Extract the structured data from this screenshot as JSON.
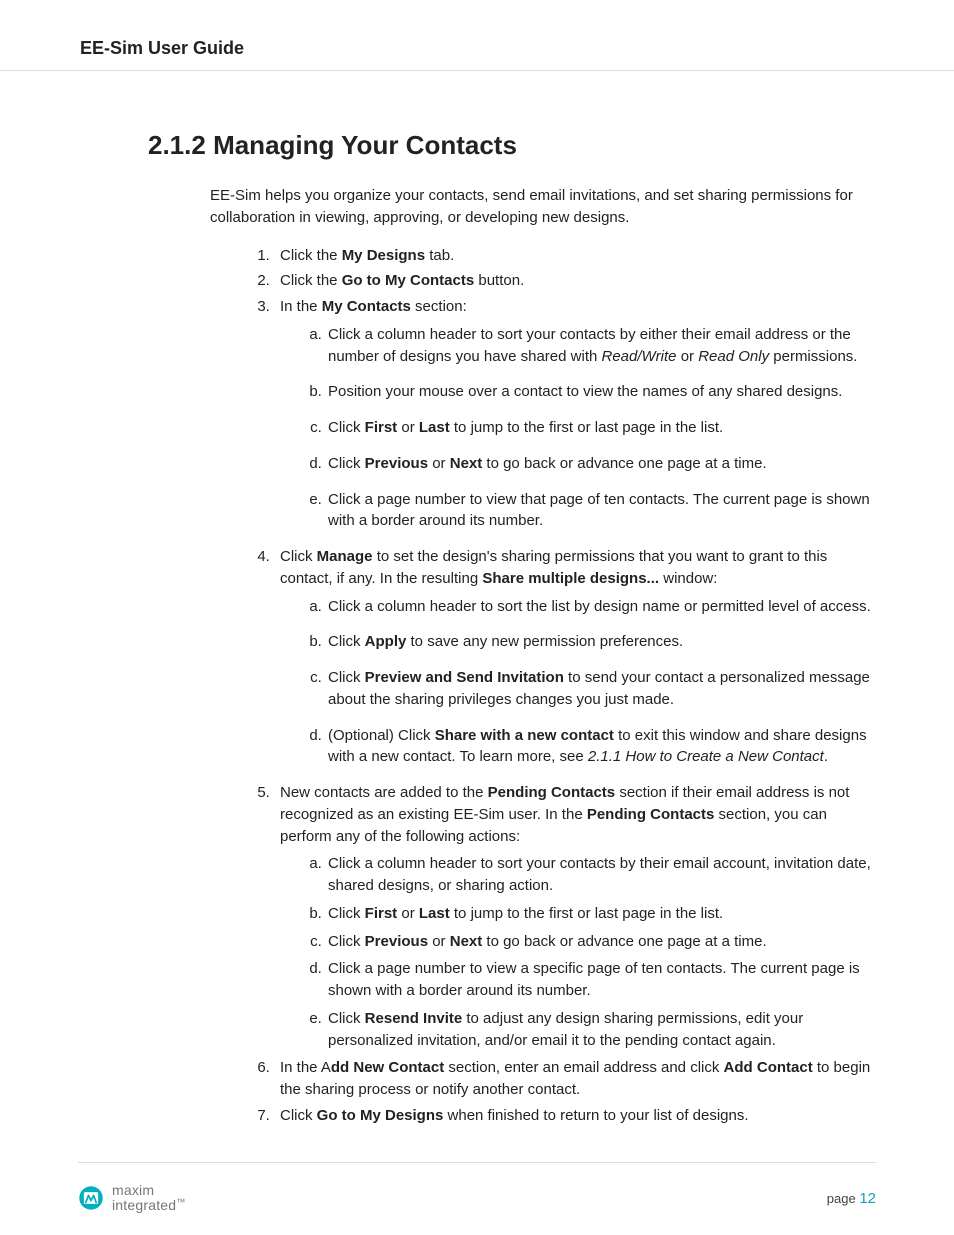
{
  "header": {
    "title": "EE-Sim User Guide"
  },
  "section": {
    "number": "2.1.2",
    "title": "Managing Your Contacts"
  },
  "intro": "EE-Sim helps you organize your contacts, send email invitations, and set sharing permissions for collaboration in viewing, approving, or developing new designs.",
  "steps": {
    "s1": {
      "pre": "Click the ",
      "b1": "My Designs",
      "post": " tab."
    },
    "s2": {
      "pre": "Click the ",
      "b1": "Go to My Contacts",
      "post": " button."
    },
    "s3": {
      "pre": "In the ",
      "b1": "My Contacts",
      "post": " section:",
      "a": {
        "t1": "Click a column header to sort your contacts by either their email address or the number of designs you have shared with ",
        "i1": "Read/Write",
        "t2": " or ",
        "i2": "Read Only",
        "t3": " permissions."
      },
      "b": "Position your mouse over a contact to view the names of any shared designs.",
      "c": {
        "t1": "Click ",
        "b1": "First",
        "t2": " or ",
        "b2": "Last",
        "t3": " to jump to the first or last page in the list."
      },
      "d": {
        "t1": "Click ",
        "b1": "Previous",
        "t2": " or ",
        "b2": "Next",
        "t3": " to go back or advance one page at a time."
      },
      "e": "Click a page number to view that page of ten contacts. The current page is shown with a border around its number."
    },
    "s4": {
      "t1": "Click ",
      "b1": "Manage",
      "t2": " to set the design's sharing permissions that you want to grant to this contact, if any. In the resulting ",
      "b2": "Share multiple designs...",
      "t3": " window:",
      "a": "Click a column header to sort the list by design name or permitted level of access.",
      "b": {
        "t1": "Click ",
        "b1": "Apply",
        "t2": " to save any new permission preferences."
      },
      "c": {
        "t1": "Click ",
        "b1": "Preview and Send Invitation",
        "t2": " to send your contact a personalized message about the sharing privileges changes you just made."
      },
      "d": {
        "t1": "(Optional) Click ",
        "b1": "Share with a new contact",
        "t2": " to exit this window and share designs with a new contact. To learn more, see ",
        "i1": "2.1.1 How to Create a New Contact",
        "t3": "."
      }
    },
    "s5": {
      "t1": "New contacts are added to the ",
      "b1": "Pending Contacts",
      "t2": " section if their email address is not recognized as an existing EE-Sim user. In the ",
      "b2": "Pending Contacts",
      "t3": " section, you can perform any of the following actions:",
      "a": "Click a column header to sort your contacts by their email account, invitation date, shared designs, or sharing action.",
      "b": {
        "t1": "Click ",
        "b1": "First",
        "t2": " or ",
        "b2": "Last",
        "t3": " to jump to the first or last page in the list."
      },
      "c": {
        "t1": "Click ",
        "b1": "Previous",
        "t2": " or ",
        "b2": "Next",
        "t3": " to go back or advance one page at a time."
      },
      "d": "Click a page number to view a specific page of ten contacts. The current page is shown with a border around its number.",
      "e": {
        "t1": "Click ",
        "b1": "Resend Invite",
        "t2": " to adjust any design sharing permissions, edit your personalized invitation, and/or email it to the pending contact again."
      }
    },
    "s6": {
      "t1": "In the A",
      "b1": "dd New Contact",
      "t2": " section, enter an email address and click ",
      "b2": "Add Contact",
      "t3": " to begin the sharing process or notify another contact."
    },
    "s7": {
      "t1": "Click ",
      "b1": "Go to My Designs",
      "t2": " when finished to return to your list of designs."
    }
  },
  "footer": {
    "logo": {
      "line1": "maxim",
      "line2": "integrated",
      "tm": "™"
    },
    "page_label": "page ",
    "page_number": "12"
  }
}
